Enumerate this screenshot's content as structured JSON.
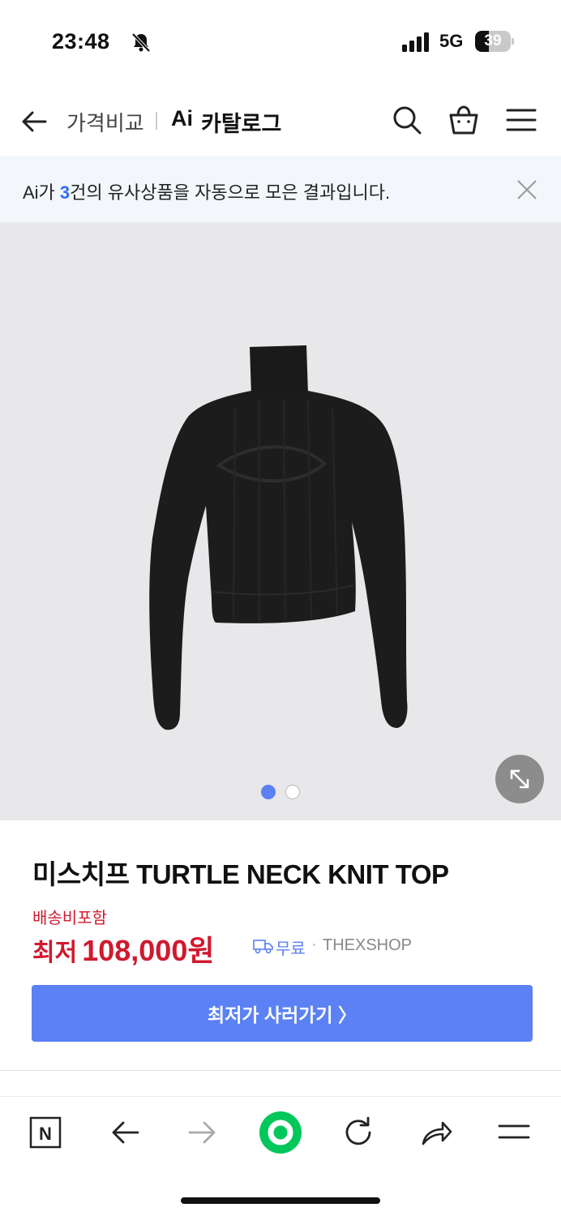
{
  "status": {
    "time": "23:48",
    "network": "5G",
    "battery": "39",
    "battery_fraction": 0.39
  },
  "header": {
    "crumb_price_compare": "가격비교",
    "catalog_ai": "Ai",
    "catalog_label": "카탈로그",
    "icons": [
      "back-arrow-icon",
      "search-icon",
      "shopping-bag-icon",
      "menu-icon"
    ]
  },
  "notice": {
    "prefix": "Ai가 ",
    "count": "3",
    "suffix": "건의 유사상품을 자동으로 모은 결과입니다."
  },
  "gallery": {
    "image_description_icon": "black-turtleneck-knit-top",
    "page_count": 2,
    "current_page": 1
  },
  "product": {
    "title": "미스치프 TURTLE NECK KNIT TOP",
    "shipping_note": "배송비포함",
    "price_prefix": "최저",
    "price": "108,000원",
    "free_shipping": "무료",
    "bullet": "·",
    "seller": "THEXSHOP",
    "cta_label": "최저가 사러가기 〉"
  },
  "colors": {
    "accent_blue": "#5b81f4",
    "price_red": "#d0192f",
    "banner_bg": "#f3f6fa",
    "gallery_bg": "#e8e8ea",
    "naver_green": "#03c75a"
  },
  "toolbar": {
    "n_logo": "N",
    "icons": [
      "naver-home-icon",
      "back-arrow-icon",
      "forward-arrow-icon",
      "green-dot-icon",
      "reload-icon",
      "share-icon",
      "menu-icon"
    ]
  }
}
